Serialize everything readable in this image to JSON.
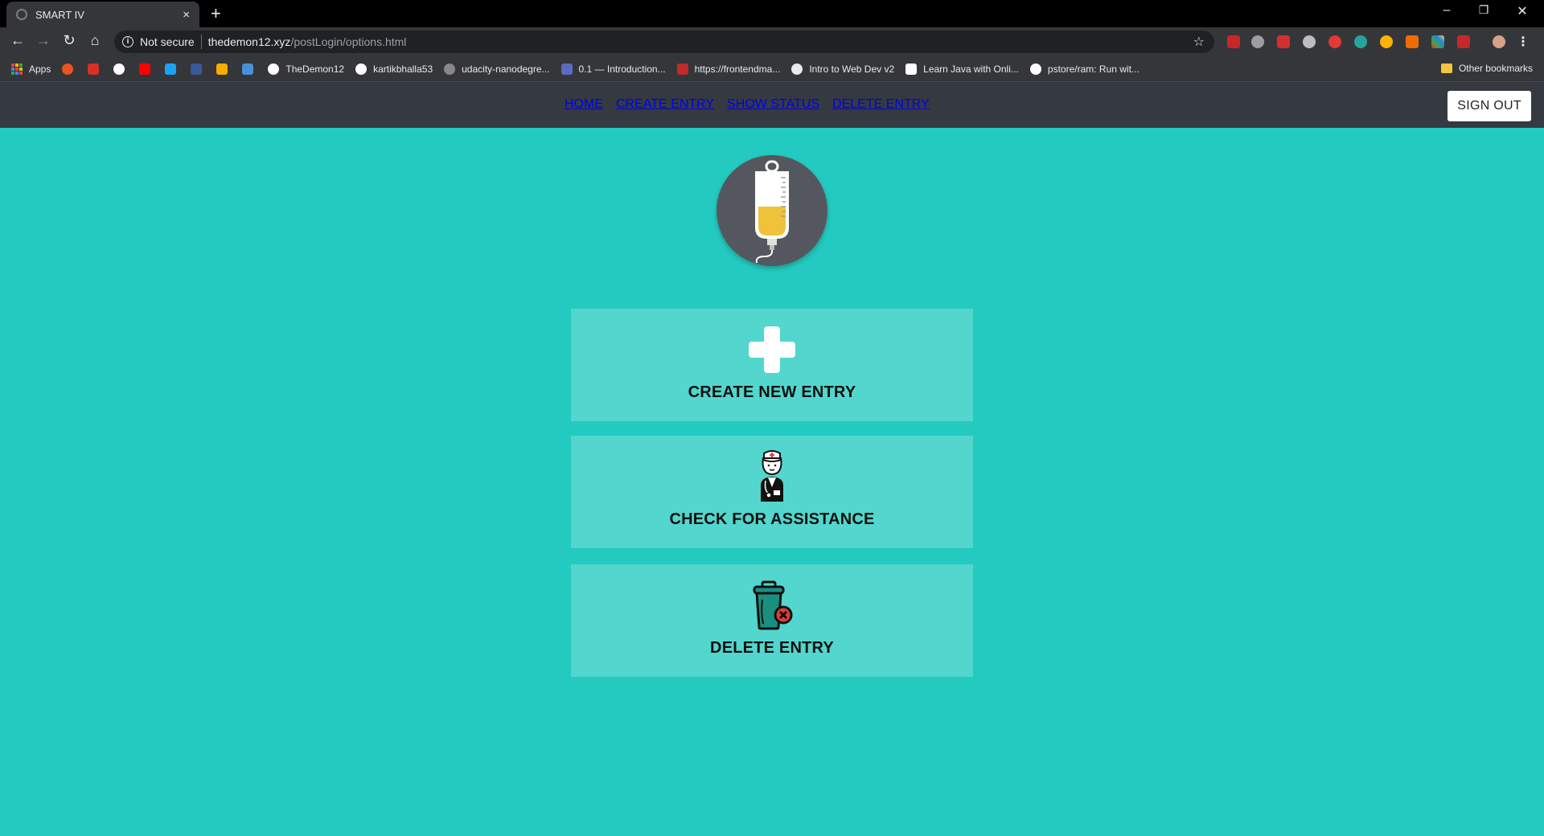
{
  "browser": {
    "tab_title": "SMART IV",
    "tab_close": "×",
    "new_tab": "+",
    "security_label": "Not secure",
    "url_host": "thedemon12.xyz",
    "url_path": "/postLogin/options.html",
    "window_controls": {
      "minimize": "–",
      "restore": "❐",
      "close": "✕"
    }
  },
  "bookmarks": {
    "items": [
      {
        "label": "Apps",
        "icon": "apps-grid-icon"
      },
      {
        "label": "",
        "icon": "ubuntu-icon",
        "color": "#e95420"
      },
      {
        "label": "",
        "icon": "gmail-icon",
        "color": "#d93025"
      },
      {
        "label": "",
        "icon": "github-icon",
        "color": "#ffffff"
      },
      {
        "label": "",
        "icon": "youtube-icon",
        "color": "#ff0000"
      },
      {
        "label": "",
        "icon": "twitter-icon",
        "color": "#1da1f2"
      },
      {
        "label": "",
        "icon": "facebook-icon",
        "color": "#3b5998"
      },
      {
        "label": "",
        "icon": "analytics-icon",
        "color": "#f9ab00"
      },
      {
        "label": "",
        "icon": "is-icon",
        "color": "#4a90d9"
      },
      {
        "label": "TheDemon12",
        "icon": "github-icon",
        "color": "#ffffff"
      },
      {
        "label": "kartikbhalla53",
        "icon": "github-icon",
        "color": "#ffffff"
      },
      {
        "label": "udacity-nanodegre...",
        "icon": "github-icon",
        "color": "#888888"
      },
      {
        "label": "0.1 — Introduction...",
        "icon": "cpp-icon",
        "color": "#5c6bc0"
      },
      {
        "label": "https://frontendma...",
        "icon": "frontendmasters-icon",
        "color": "#c02d28"
      },
      {
        "label": "Intro to Web Dev v2",
        "icon": "globe-icon",
        "color": "#e8eaed"
      },
      {
        "label": "Learn Java with Onli...",
        "icon": "edx-icon",
        "color": "#ffffff"
      },
      {
        "label": "pstore/ram: Run wit...",
        "icon": "github-icon",
        "color": "#ffffff"
      }
    ],
    "other": "Other bookmarks"
  },
  "nav": {
    "links": [
      "HOME",
      "CREATE ENTRY",
      "SHOW STATUS",
      "DELETE ENTRY"
    ],
    "active_index": 0,
    "signout_label": "SIGN OUT"
  },
  "cards": [
    {
      "label": "CREATE NEW ENTRY",
      "icon": "plus-icon"
    },
    {
      "label": "CHECK FOR ASSISTANCE",
      "icon": "nurse-icon"
    },
    {
      "label": "DELETE ENTRY",
      "icon": "trash-delete-icon"
    }
  ],
  "colors": {
    "page_background": "#23cac0",
    "card_background": "#52d6cd",
    "navbar": "#343a40",
    "iv_fluid": "#f0c23a"
  }
}
